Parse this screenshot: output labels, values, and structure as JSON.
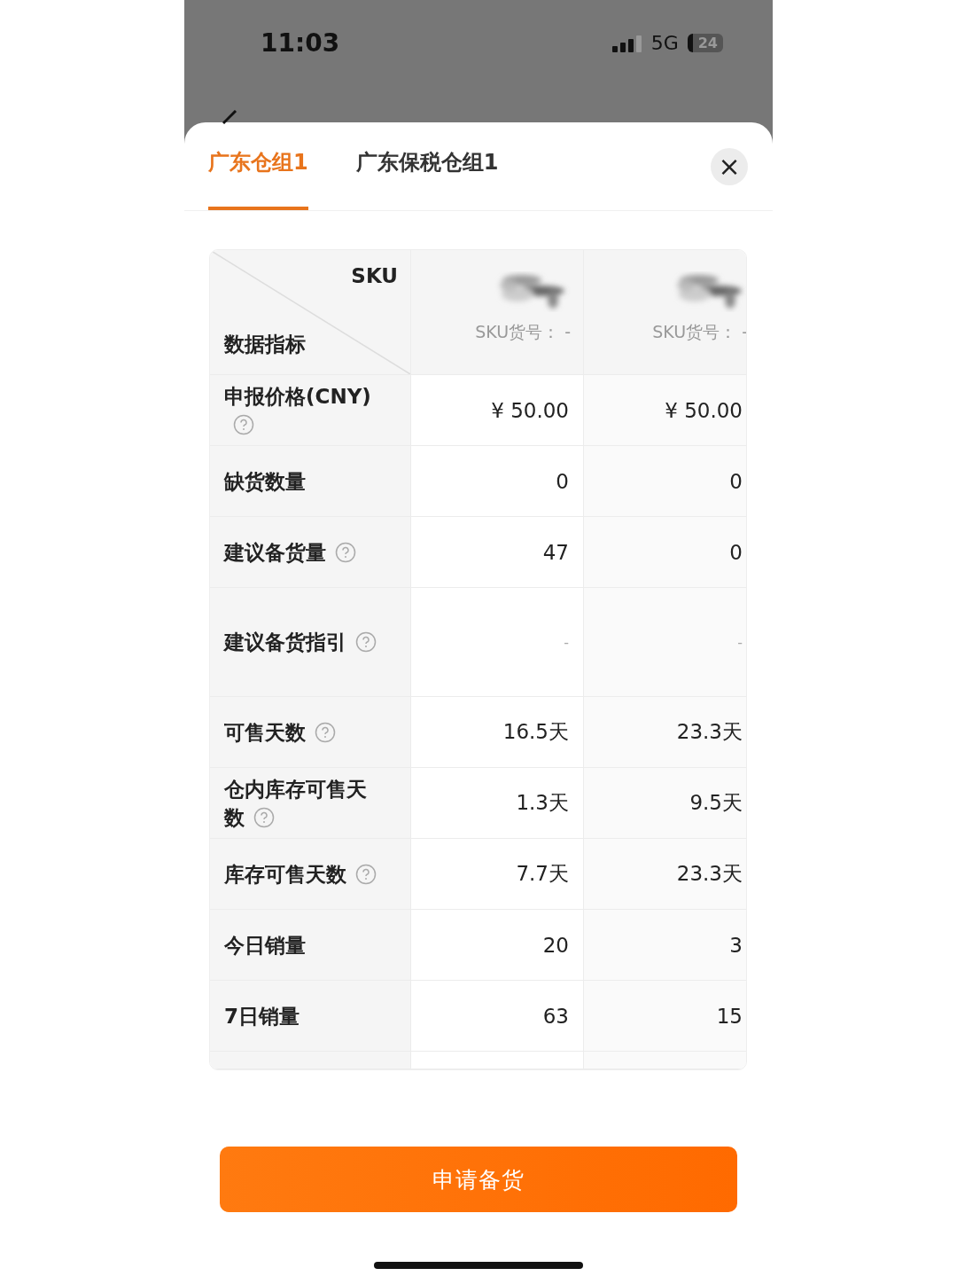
{
  "status_bar": {
    "time": "11:03",
    "network": "5G",
    "battery": "24"
  },
  "tabs": [
    {
      "label": "广东仓组1",
      "selected": true
    },
    {
      "label": "广东保税仓组1",
      "selected": false
    }
  ],
  "close_button": "×",
  "table": {
    "corner": {
      "top": "SKU",
      "bottom": "数据指标"
    },
    "sku_columns": [
      {
        "sku_no": "SKU货号： -"
      },
      {
        "sku_no": "SKU货号： -"
      }
    ],
    "rows": [
      {
        "label": "申报价格(CNY)",
        "help": true,
        "tall": false,
        "values": [
          "¥ 50.00",
          "¥ 50.00"
        ]
      },
      {
        "label": "缺货数量",
        "help": false,
        "tall": false,
        "values": [
          "0",
          "0"
        ]
      },
      {
        "label": "建议备货量",
        "help": true,
        "tall": false,
        "values": [
          "47",
          "0"
        ]
      },
      {
        "label": "建议备货指引",
        "help": true,
        "tall": true,
        "values": [
          "-",
          "-"
        ]
      },
      {
        "label": "可售天数",
        "help": true,
        "tall": false,
        "values": [
          "16.5天",
          "23.3天"
        ]
      },
      {
        "label": "仓内库存可售天数",
        "help": true,
        "tall": false,
        "values": [
          "1.3天",
          "9.5天"
        ]
      },
      {
        "label": "库存可售天数",
        "help": true,
        "tall": false,
        "values": [
          "7.7天",
          "23.3天"
        ]
      },
      {
        "label": "今日销量",
        "help": false,
        "tall": false,
        "values": [
          "20",
          "3"
        ]
      },
      {
        "label": "7日销量",
        "help": false,
        "tall": false,
        "values": [
          "63",
          "15"
        ]
      }
    ]
  },
  "submit_button": "申请备货"
}
